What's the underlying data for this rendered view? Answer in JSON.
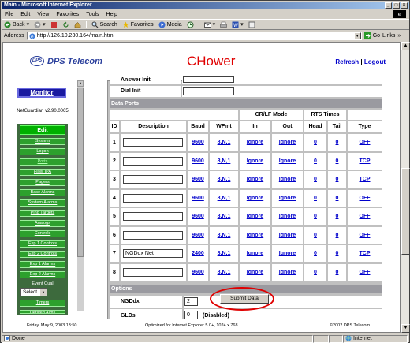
{
  "window": {
    "title": "Main - Microsoft Internet Explorer"
  },
  "menu": [
    "File",
    "Edit",
    "View",
    "Favorites",
    "Tools",
    "Help"
  ],
  "toolbar": {
    "back": "Back",
    "search": "Search",
    "favorites": "Favorites",
    "media": "Media"
  },
  "address": {
    "label": "Address",
    "url": "http://126.10.230.164/main.html",
    "go": "Go",
    "links": "Links"
  },
  "header": {
    "logo_text": "DPS Telecom",
    "logo_mark": "DPS",
    "site_name": "CHower",
    "refresh": "Refresh",
    "separator": "|",
    "logout": "Logout"
  },
  "sidebar": {
    "monitor": "Monitor",
    "version": "NetGuardian v2.90.0065",
    "edit": "Edit",
    "items": [
      "System",
      "Logon",
      "Ports",
      "Filter IPA",
      "Pagers",
      "Base Alarms",
      "System Alarms",
      "Ping Targets",
      "Analogs",
      "Controls",
      "Exp 1 Controls",
      "Exp 2 Controls",
      "Exp 1 Alarms",
      "Exp 2 Alarms"
    ],
    "event_qual": "Event Qual",
    "select_value": "Select",
    "after_items": [
      "Timers",
      "Derived Alms"
    ]
  },
  "form": {
    "answer_init_label": "Answer Init",
    "dial_init_label": "Dial Init",
    "data_ports_title": "Data Ports",
    "group_headers": {
      "crlf": "CR/LF Mode",
      "rts": "RTS Times"
    },
    "columns": [
      "ID",
      "Description",
      "Baud",
      "WFmt",
      "In",
      "Out",
      "Head",
      "Tail",
      "Type"
    ],
    "rows": [
      {
        "id": "1",
        "description": "",
        "baud": "9600",
        "wfmt": "8,N,1",
        "in": "Ignore",
        "out": "Ignore",
        "head": "0",
        "tail": "0",
        "type": "OFF"
      },
      {
        "id": "2",
        "description": "",
        "baud": "9600",
        "wfmt": "8,N,1",
        "in": "Ignore",
        "out": "Ignore",
        "head": "0",
        "tail": "0",
        "type": "TCP"
      },
      {
        "id": "3",
        "description": "",
        "baud": "9600",
        "wfmt": "8,N,1",
        "in": "Ignore",
        "out": "Ignore",
        "head": "0",
        "tail": "0",
        "type": "TCP"
      },
      {
        "id": "4",
        "description": "",
        "baud": "9600",
        "wfmt": "8,N,1",
        "in": "Ignore",
        "out": "Ignore",
        "head": "0",
        "tail": "0",
        "type": "OFF"
      },
      {
        "id": "5",
        "description": "",
        "baud": "9600",
        "wfmt": "8,N,1",
        "in": "Ignore",
        "out": "Ignore",
        "head": "0",
        "tail": "0",
        "type": "OFF"
      },
      {
        "id": "6",
        "description": "",
        "baud": "9600",
        "wfmt": "8,N,1",
        "in": "Ignore",
        "out": "Ignore",
        "head": "0",
        "tail": "0",
        "type": "OFF"
      },
      {
        "id": "7",
        "description": "NGDdx Net",
        "baud": "2400",
        "wfmt": "8,N,1",
        "in": "Ignore",
        "out": "Ignore",
        "head": "0",
        "tail": "0",
        "type": "TCP"
      },
      {
        "id": "8",
        "description": "",
        "baud": "9600",
        "wfmt": "8,N,1",
        "in": "Ignore",
        "out": "Ignore",
        "head": "0",
        "tail": "0",
        "type": "OFF"
      }
    ],
    "options_title": "Options",
    "ngddx_label": "NGDdx",
    "ngddx_value": "2",
    "glds_label": "GLDs",
    "glds_value": "0",
    "glds_note": "(Disabled)",
    "submit": "Submit Data"
  },
  "footer": {
    "date": "Friday, May 9, 2003  13:50",
    "optimized": "Optimized for Internet Explorer 5.0+, 1024 x 768",
    "copyright": "©2002 DPS Telecom"
  },
  "status": {
    "left": "Done",
    "zone": "Internet"
  }
}
